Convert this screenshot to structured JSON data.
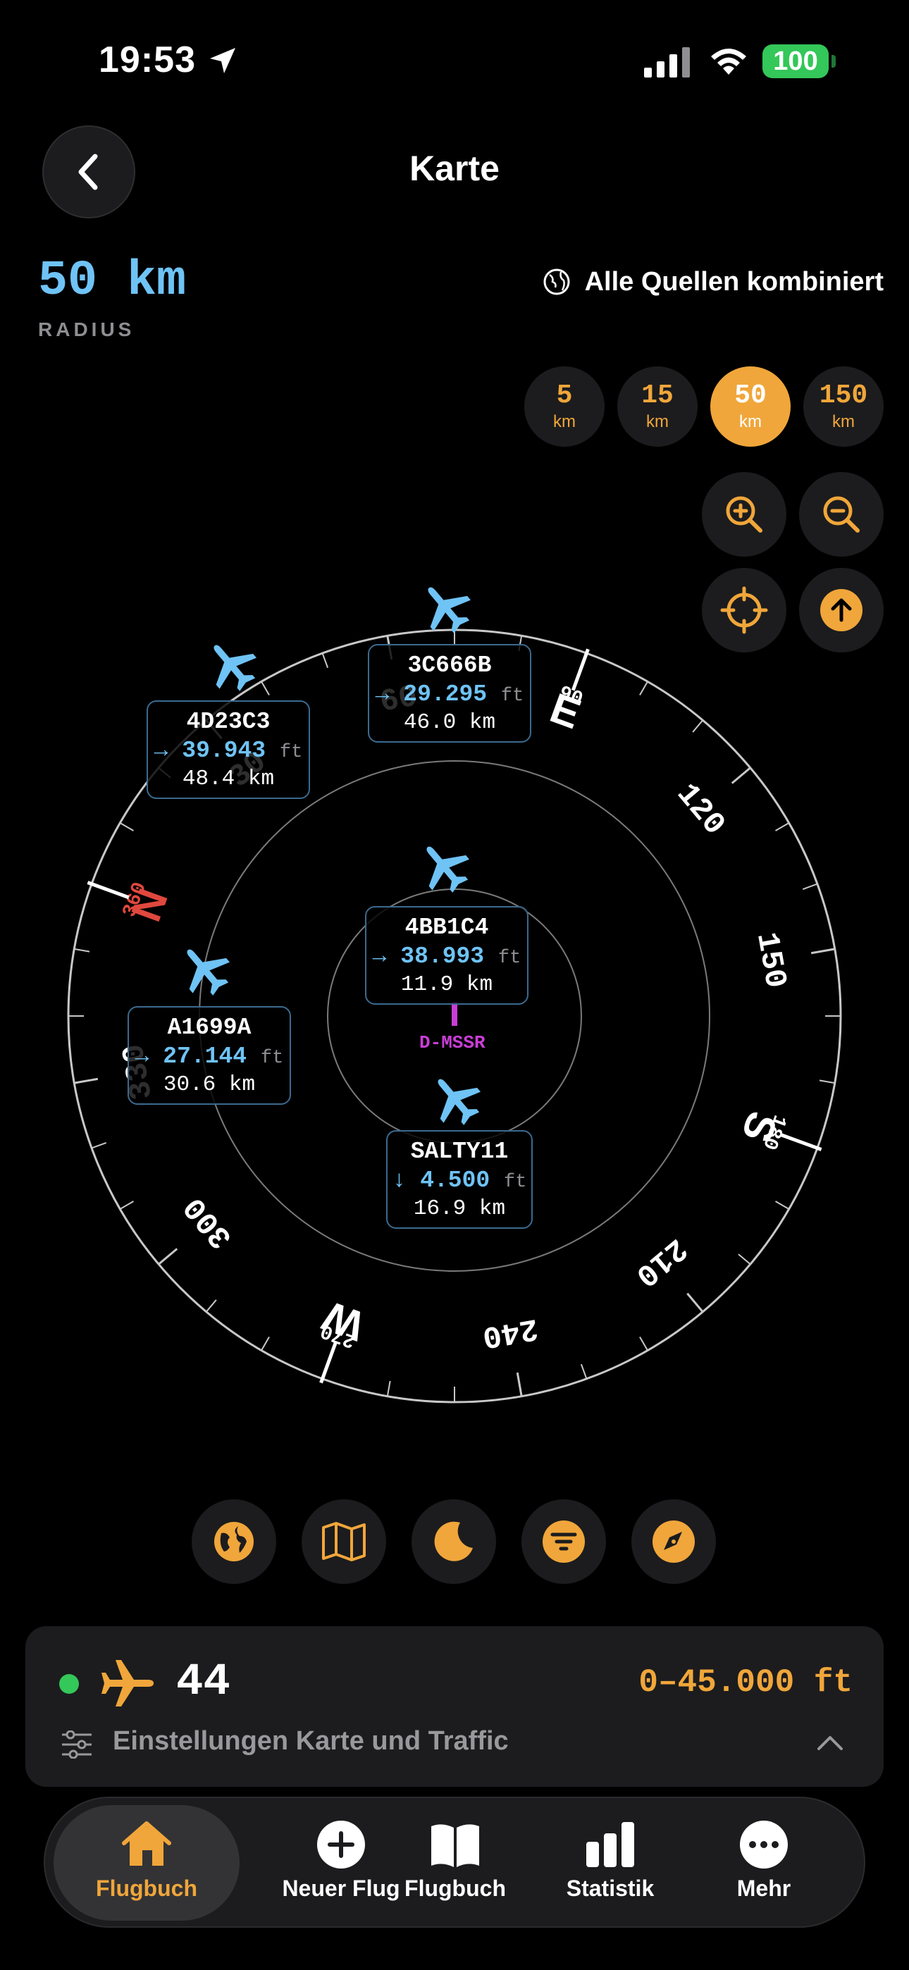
{
  "status": {
    "time": "19:53",
    "battery": "100"
  },
  "header": {
    "title": "Karte"
  },
  "radius": {
    "value": "50 km",
    "label": "RADIUS"
  },
  "sources": {
    "label": "Alle Quellen kombiniert"
  },
  "range_buttons": [
    {
      "num": "5",
      "unit": "km",
      "selected": false
    },
    {
      "num": "15",
      "unit": "km",
      "selected": false
    },
    {
      "num": "50",
      "unit": "km",
      "selected": true
    },
    {
      "num": "150",
      "unit": "km",
      "selected": false
    }
  ],
  "compass": {
    "cardinals": {
      "N": "N",
      "E": "E",
      "S": "S",
      "W": "W"
    },
    "degree_labels": [
      "30",
      "60",
      "90",
      "120",
      "150",
      "180",
      "210",
      "240",
      "270",
      "300",
      "330",
      "360"
    ],
    "heading_deg": 70
  },
  "own_aircraft": {
    "registration": "D-MSSR"
  },
  "aircraft": [
    {
      "callsign": "3C666B",
      "altitude": "29.295",
      "unit": "ft",
      "distance": "46.0 km",
      "trend": "→"
    },
    {
      "callsign": "4D23C3",
      "altitude": "39.943",
      "unit": "ft",
      "distance": "48.4 km",
      "trend": "→"
    },
    {
      "callsign": "4BB1C4",
      "altitude": "38.993",
      "unit": "ft",
      "distance": "11.9 km",
      "trend": "→"
    },
    {
      "callsign": "A1699A",
      "altitude": "27.144",
      "unit": "ft",
      "distance": "30.6 km",
      "trend": "→"
    },
    {
      "callsign": "SALTY11",
      "altitude": "4.500",
      "unit": "ft",
      "distance": "16.9 km",
      "trend": "↓"
    }
  ],
  "traffic": {
    "count": "44",
    "altitude_range": "0–45.000 ft",
    "settings_label": "Einstellungen Karte und Traffic"
  },
  "tabs": [
    {
      "label": "Flugbuch",
      "icon": "house-icon",
      "active": true
    },
    {
      "label": "Neuer Flug",
      "icon": "plus-circle-icon",
      "active": false
    },
    {
      "label": "Flugbuch",
      "icon": "book-icon",
      "active": false
    },
    {
      "label": "Statistik",
      "icon": "bar-chart-icon",
      "active": false
    },
    {
      "label": "Mehr",
      "icon": "ellipsis-circle-icon",
      "active": false
    }
  ],
  "colors": {
    "accent": "#f0a63a",
    "aircraft_blue": "#6fc3f5",
    "own_aircraft": "#c93ed6",
    "north": "#e0483e",
    "live": "#34c759"
  }
}
